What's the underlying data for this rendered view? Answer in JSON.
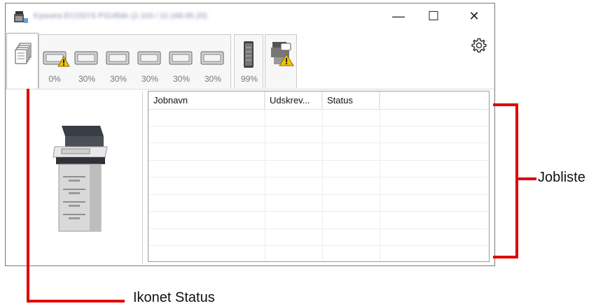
{
  "window": {
    "title": "Kyocera ECOSYS P3145dn (2.103 / 10.168.65.20)",
    "controls": {
      "minimize": "—",
      "maximize": "☐",
      "close": "✕"
    }
  },
  "status_tabs": {
    "toner_levels": [
      "0%",
      "30%",
      "30%",
      "30%",
      "30%",
      "30%"
    ],
    "waste_toner_level": "99%",
    "collapse_glyph": "︽"
  },
  "joblist": {
    "columns": [
      "Jobnavn",
      "Udskrev...",
      "Status",
      ""
    ],
    "rows": []
  },
  "callouts": {
    "joblist_label": "Jobliste",
    "status_icon_label": "Ikonet Status"
  },
  "colors": {
    "callout_red": "#e00000",
    "warning_yellow": "#f2c200"
  },
  "icons": {
    "app": "printer-app-icon",
    "status": "document-stack-icon",
    "tray": "paper-tray-icon",
    "warning": "warning-icon",
    "toner": "toner-cartridge-icon",
    "device": "printer-warning-icon",
    "settings": "gear-icon"
  }
}
